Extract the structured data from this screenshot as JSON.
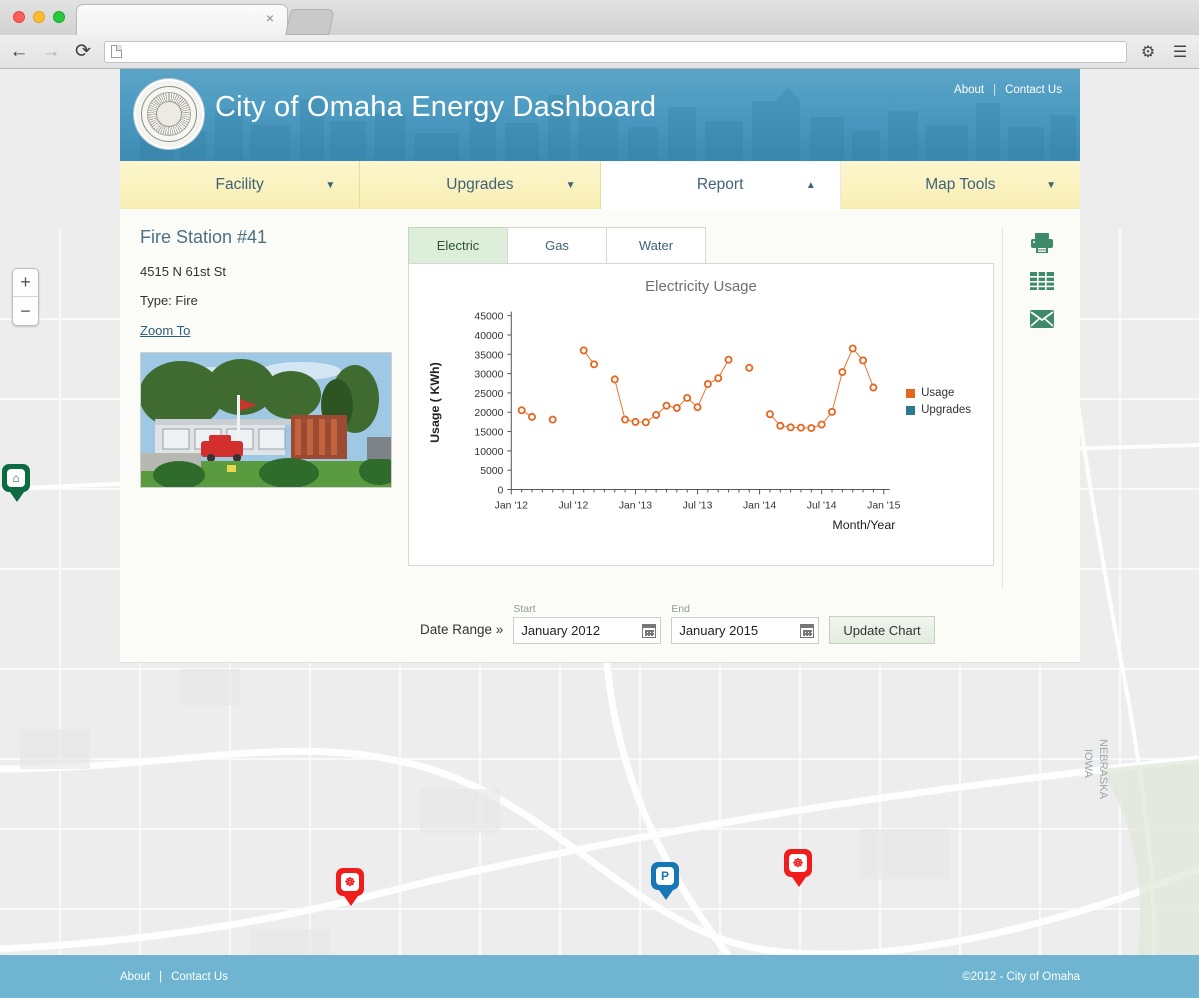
{
  "browser": {
    "tab_title": "",
    "url": "",
    "back_icon": "back-arrow-icon",
    "forward_icon": "forward-arrow-icon",
    "reload_icon": "reload-icon",
    "settings_icon": "gear-icon",
    "menu_icon": "hamburger-menu-icon",
    "close_tab_label": "×"
  },
  "header": {
    "title": "City of Omaha Energy Dashboard",
    "links": [
      {
        "label": "About"
      },
      {
        "label": "Contact Us"
      }
    ],
    "separator": "|",
    "seal_name": "city-of-omaha-seal",
    "bg_color": "#4e9cc2"
  },
  "nav": {
    "tabs": [
      {
        "label": "Facility",
        "arrow": "▼",
        "active": false
      },
      {
        "label": "Upgrades",
        "arrow": "▼",
        "active": false
      },
      {
        "label": "Report",
        "arrow": "▲",
        "active": true
      },
      {
        "label": "Map Tools",
        "arrow": "▼",
        "active": false
      }
    ],
    "tab_color": "#f8eeb2"
  },
  "facility": {
    "name": "Fire Station #41",
    "address": "4515 N 61st St",
    "type": "Type: Fire",
    "zoom_to": "Zoom To",
    "photo_alt": "fire-station-photo"
  },
  "utility_tabs": [
    {
      "label": "Electric",
      "active": true
    },
    {
      "label": "Gas",
      "active": false
    },
    {
      "label": "Water",
      "active": false
    }
  ],
  "side_tools": [
    {
      "name": "print-icon",
      "glyph": "⎙"
    },
    {
      "name": "table-icon",
      "glyph": "▦"
    },
    {
      "name": "email-icon",
      "glyph": "✉"
    }
  ],
  "date_range": {
    "label": "Date Range »",
    "start_caption": "Start",
    "start_value": "January 2012",
    "start_placeholder": "January 2012",
    "end_caption": "End",
    "end_value": "January 2015",
    "end_placeholder": "January 2015",
    "calendar_icon": "calendar-icon",
    "update_button": "Update Chart"
  },
  "footer": {
    "links": [
      {
        "label": "About"
      },
      {
        "label": "Contact Us"
      }
    ],
    "separator": "|",
    "copyright": "©2012 - City of Omaha",
    "bg_color": "#6fb4d1"
  },
  "map": {
    "zoom_in": "+",
    "zoom_out": "−",
    "markers": [
      {
        "name": "marker-fire",
        "kind": "fire",
        "glyph": "☸",
        "x": 336,
        "y": 799
      },
      {
        "name": "marker-police",
        "kind": "police",
        "glyph": "P",
        "x": 651,
        "y": 793
      },
      {
        "name": "marker-fire",
        "kind": "fire",
        "glyph": "☸",
        "x": 784,
        "y": 780
      },
      {
        "name": "marker-library",
        "kind": "library",
        "glyph": "⌂",
        "x": 744,
        "y": 898
      },
      {
        "name": "marker-library",
        "kind": "library",
        "glyph": "⌂",
        "x": 2,
        "y": 395
      }
    ]
  },
  "chart_data": {
    "type": "scatter",
    "title": "Electricity Usage",
    "xlabel": "Month/Year",
    "ylabel": "Usage ( KWh)",
    "ylim": [
      0,
      45000
    ],
    "yticks": [
      0,
      5000,
      10000,
      15000,
      20000,
      25000,
      30000,
      35000,
      40000,
      45000
    ],
    "xticks": [
      "Jan '12",
      "Jul '12",
      "Jan '13",
      "Jul '13",
      "Jan '14",
      "Jul '14",
      "Jan '15"
    ],
    "xlim_months": [
      0,
      36
    ],
    "grid": false,
    "legend_position": "right",
    "legend": [
      {
        "name": "Usage",
        "color": "#e8651f"
      },
      {
        "name": "Upgrades",
        "color": "#2a7a96"
      }
    ],
    "series": [
      {
        "name": "Usage",
        "color": "#e8651f",
        "marker": "open-circle",
        "points": [
          {
            "x": 1,
            "y": 20500
          },
          {
            "x": 2,
            "y": 18800
          },
          {
            "x": 4,
            "y": 18100
          },
          {
            "x": 7,
            "y": 36000
          },
          {
            "x": 8,
            "y": 32400
          },
          {
            "x": 10,
            "y": 28500
          },
          {
            "x": 11,
            "y": 18100
          },
          {
            "x": 12,
            "y": 17500
          },
          {
            "x": 13,
            "y": 17400
          },
          {
            "x": 14,
            "y": 19300
          },
          {
            "x": 15,
            "y": 21700
          },
          {
            "x": 16,
            "y": 21100
          },
          {
            "x": 17,
            "y": 23700
          },
          {
            "x": 18,
            "y": 21300
          },
          {
            "x": 19,
            "y": 27300
          },
          {
            "x": 20,
            "y": 28800
          },
          {
            "x": 21,
            "y": 33600
          },
          {
            "x": 23,
            "y": 31500
          },
          {
            "x": 25,
            "y": 19500
          },
          {
            "x": 26,
            "y": 16500
          },
          {
            "x": 27,
            "y": 16100
          },
          {
            "x": 28,
            "y": 16000
          },
          {
            "x": 29,
            "y": 15900
          },
          {
            "x": 30,
            "y": 16800
          },
          {
            "x": 31,
            "y": 20100
          },
          {
            "x": 32,
            "y": 30400
          },
          {
            "x": 33,
            "y": 36500
          },
          {
            "x": 34,
            "y": 33400
          },
          {
            "x": 35,
            "y": 26400
          }
        ]
      },
      {
        "name": "Upgrades",
        "color": "#2a7a96",
        "marker": "square",
        "points": []
      }
    ]
  }
}
